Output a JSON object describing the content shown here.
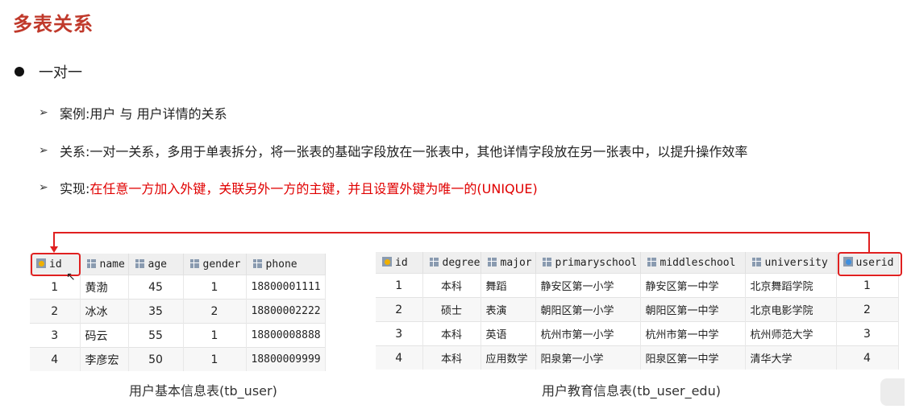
{
  "title": "多表关系",
  "section": {
    "label": "一对一"
  },
  "bullets": [
    {
      "prefix": "案例: ",
      "text": "用户 与 用户详情的关系",
      "red": ""
    },
    {
      "prefix": "关系: ",
      "text": "一对一关系，多用于单表拆分，将一张表的基础字段放在一张表中，其他详情字段放在另一张表中，以提升操作效率",
      "red": ""
    },
    {
      "prefix": "实现: ",
      "text": "",
      "red": "在任意一方加入外键，关联另外一方的主键，并且设置外键为唯一的(UNIQUE)"
    }
  ],
  "tb_user": {
    "caption": "用户基本信息表(tb_user)",
    "columns": [
      "id",
      "name",
      "age",
      "gender",
      "phone"
    ],
    "rows": [
      [
        "1",
        "黄渤",
        "45",
        "1",
        "18800001111"
      ],
      [
        "2",
        "冰冰",
        "35",
        "2",
        "18800002222"
      ],
      [
        "3",
        "码云",
        "55",
        "1",
        "18800008888"
      ],
      [
        "4",
        "李彦宏",
        "50",
        "1",
        "18800009999"
      ]
    ]
  },
  "tb_user_edu": {
    "caption": "用户教育信息表(tb_user_edu)",
    "columns": [
      "id",
      "degree",
      "major",
      "primaryschool",
      "middleschool",
      "university",
      "userid"
    ],
    "rows": [
      [
        "1",
        "本科",
        "舞蹈",
        "静安区第一小学",
        "静安区第一中学",
        "北京舞蹈学院",
        "1"
      ],
      [
        "2",
        "硕士",
        "表演",
        "朝阳区第一小学",
        "朝阳区第一中学",
        "北京电影学院",
        "2"
      ],
      [
        "3",
        "本科",
        "英语",
        "杭州市第一小学",
        "杭州市第一中学",
        "杭州师范大学",
        "3"
      ],
      [
        "4",
        "本科",
        "应用数学",
        "阳泉第一小学",
        "阳泉区第一中学",
        "清华大学",
        "4"
      ]
    ]
  },
  "colors": {
    "title": "#c0392b",
    "highlight": "#e02020",
    "header_bg": "#efefef"
  },
  "icons": {
    "primary_key": "key-icon",
    "foreign_key": "foreign-key-icon",
    "column": "column-icon",
    "bullet": "arrow-icon"
  }
}
